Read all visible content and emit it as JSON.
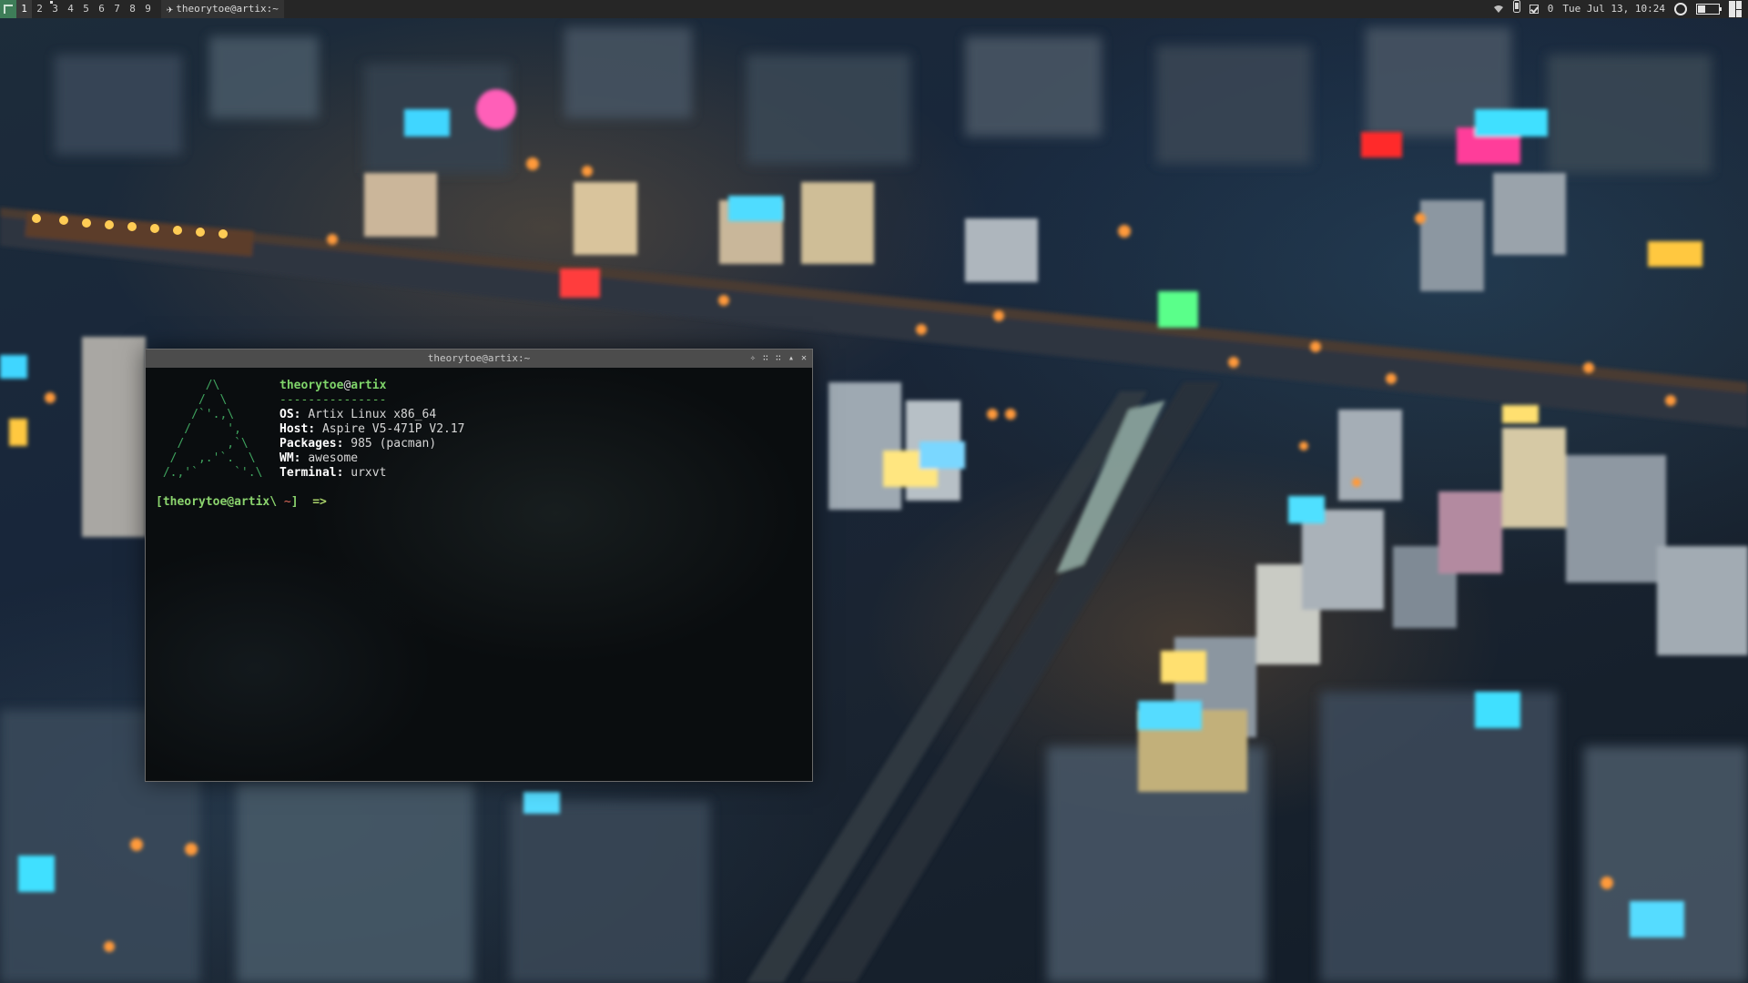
{
  "topbar": {
    "tags": [
      "1",
      "2",
      "3",
      "4",
      "5",
      "6",
      "7",
      "8",
      "9"
    ],
    "active_tag": "1",
    "occupied_tag": "3",
    "task": {
      "icon": "terminal-app-icon",
      "title": "theorytoe@artix:~"
    },
    "tray": {
      "notification_count": "0",
      "datetime": "Tue Jul 13, 10:24",
      "battery_level": 0.35,
      "icons": [
        "wifi-icon",
        "usb-drive-icon",
        "checkbox-icon",
        "circle-status-icon",
        "battery-icon",
        "layout-icon"
      ]
    }
  },
  "terminal": {
    "title": "theorytoe@artix:~",
    "titlebar_buttons": [
      "sticky-icon",
      "ontop-icon",
      "floating-icon",
      "maximize-icon",
      "close-icon"
    ],
    "fetch": {
      "user": "theorytoe",
      "at": "@",
      "host": "artix",
      "separator": "---------------",
      "lines": [
        {
          "key": "OS",
          "value": "Artix Linux x86_64"
        },
        {
          "key": "Host",
          "value": "Aspire V5-471P V2.17"
        },
        {
          "key": "Packages",
          "value": "985 (pacman)"
        },
        {
          "key": "WM",
          "value": "awesome"
        },
        {
          "key": "Terminal",
          "value": "urxvt"
        }
      ],
      "logo": "artix-logo-icon"
    },
    "prompt": {
      "user_host": "[theorytoe@artix\\",
      "path": "~",
      "close": "]",
      "arrow": "=>"
    }
  },
  "colors": {
    "bar": "#262626",
    "accent_green": "#3fa35e",
    "terminal_bg": "#0a0d0f"
  }
}
